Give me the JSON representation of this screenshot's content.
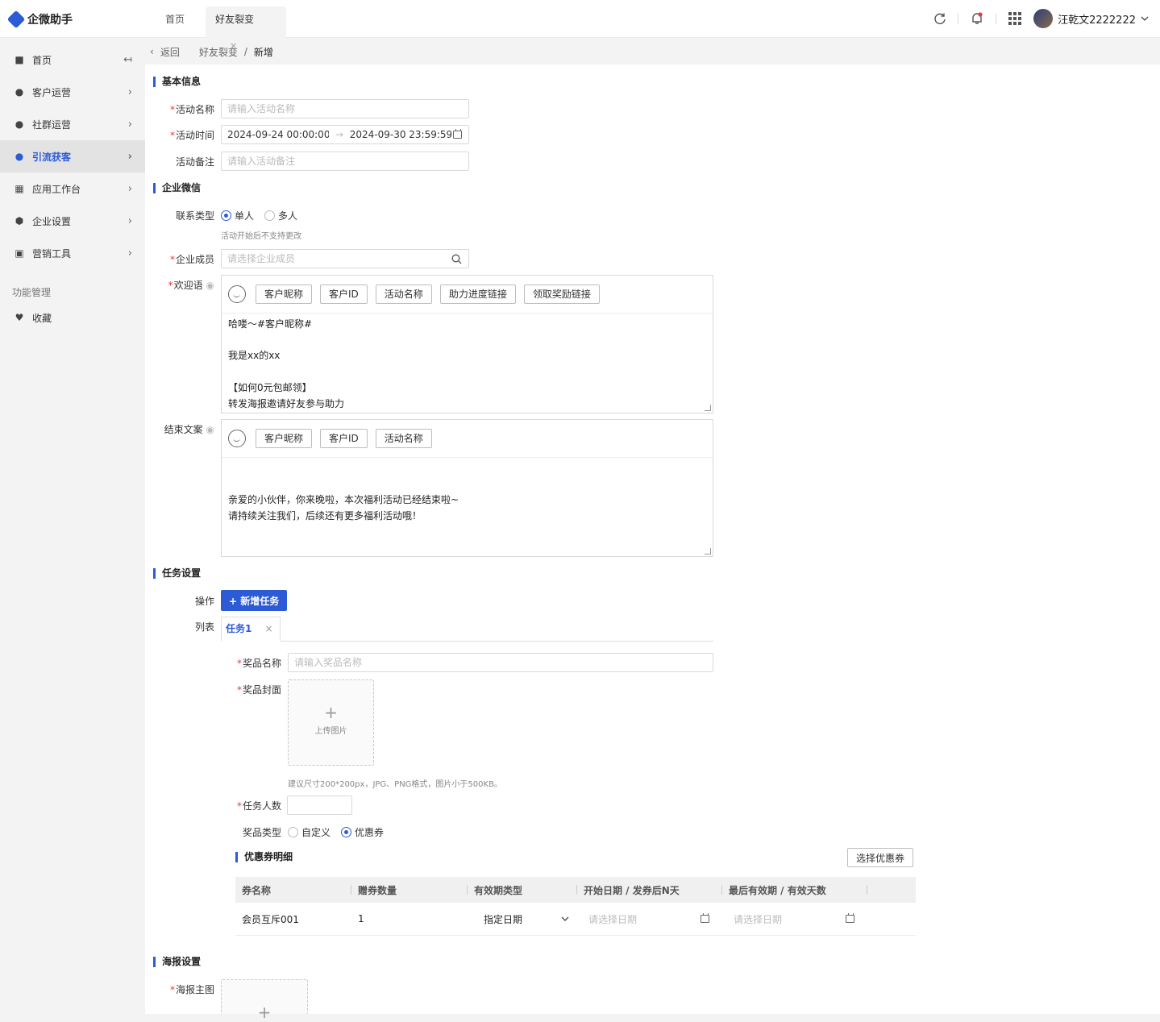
{
  "app": {
    "title": "企微助手"
  },
  "tabs": [
    {
      "label": "首页"
    },
    {
      "label": "好友裂变",
      "close": "×"
    }
  ],
  "header": {
    "user": "汪乾文2222222"
  },
  "sidebar": {
    "collapse_icon": "collapse-icon",
    "items": [
      {
        "label": "首页",
        "icon": "home-icon"
      },
      {
        "label": "客户运营",
        "icon": "user-icon"
      },
      {
        "label": "社群运营",
        "icon": "group-icon"
      },
      {
        "label": "引流获客",
        "icon": "traffic-icon",
        "active": true
      },
      {
        "label": "应用工作台",
        "icon": "apps-icon"
      },
      {
        "label": "企业设置",
        "icon": "settings-icon"
      },
      {
        "label": "营销工具",
        "icon": "chart-icon"
      }
    ],
    "group_label": "功能管理",
    "favorites": {
      "label": "收藏",
      "icon": "heart-icon"
    }
  },
  "breadcrumb": {
    "back": "返回",
    "parent": "好友裂变",
    "sep": "/",
    "current": "新增"
  },
  "basic": {
    "title": "基本信息",
    "name_label": "活动名称",
    "name_placeholder": "请输入活动名称",
    "time_label": "活动时间",
    "time_start": "2024-09-24 00:00:00",
    "time_arrow": "→",
    "time_end": "2024-09-30 23:59:59",
    "remark_label": "活动备注",
    "remark_placeholder": "请输入活动备注"
  },
  "wecom": {
    "title": "企业微信",
    "contact_label": "联系类型",
    "single": "单人",
    "multi": "多人",
    "contact_hint": "活动开始后不支持更改",
    "member_label": "企业成员",
    "member_placeholder": "请选择企业成员",
    "welcome_label": "欢迎语",
    "welcome_buttons": [
      "客户昵称",
      "客户ID",
      "活动名称",
      "助力进度链接",
      "领取奖励链接"
    ],
    "welcome_text": "哈喽～#客户昵称#\n\n我是xx的xx\n\n【如何0元包邮领】\n转发海报邀请好友参与助力",
    "end_label": "结束文案",
    "end_buttons": [
      "客户昵称",
      "客户ID",
      "活动名称"
    ],
    "end_text": "\n\n亲爱的小伙伴，你来晚啦，本次福利活动已经结束啦~\n请持续关注我们，后续还有更多福利活动哦！"
  },
  "task": {
    "title": "任务设置",
    "op_label": "操作",
    "add_button": "+ 新增任务",
    "list_label": "列表",
    "tab_label": "任务1",
    "tab_close": "×",
    "prize_name_label": "奖品名称",
    "prize_name_placeholder": "请输入奖品名称",
    "prize_cover_label": "奖品封面",
    "upload_plus": "+",
    "upload_text": "上传图片",
    "cover_hint": "建议尺寸200*200px，JPG、PNG格式，图片小于500KB。",
    "count_label": "任务人数",
    "prize_type_label": "奖品类型",
    "custom": "自定义",
    "coupon": "优惠券",
    "coupon_detail_title": "优惠券明细",
    "select_coupon": "选择优惠券",
    "table": {
      "columns": [
        "券名称",
        "赠券数量",
        "有效期类型",
        "开始日期 / 发券后N天",
        "最后有效期 / 有效天数"
      ],
      "rows": [
        {
          "name": "会员互斥001",
          "qty": "1",
          "type": "指定日期",
          "start_placeholder": "请选择日期",
          "end_placeholder": "请选择日期"
        }
      ]
    }
  },
  "poster": {
    "title": "海报设置",
    "main_label": "海报主图",
    "upload_plus": "+"
  }
}
